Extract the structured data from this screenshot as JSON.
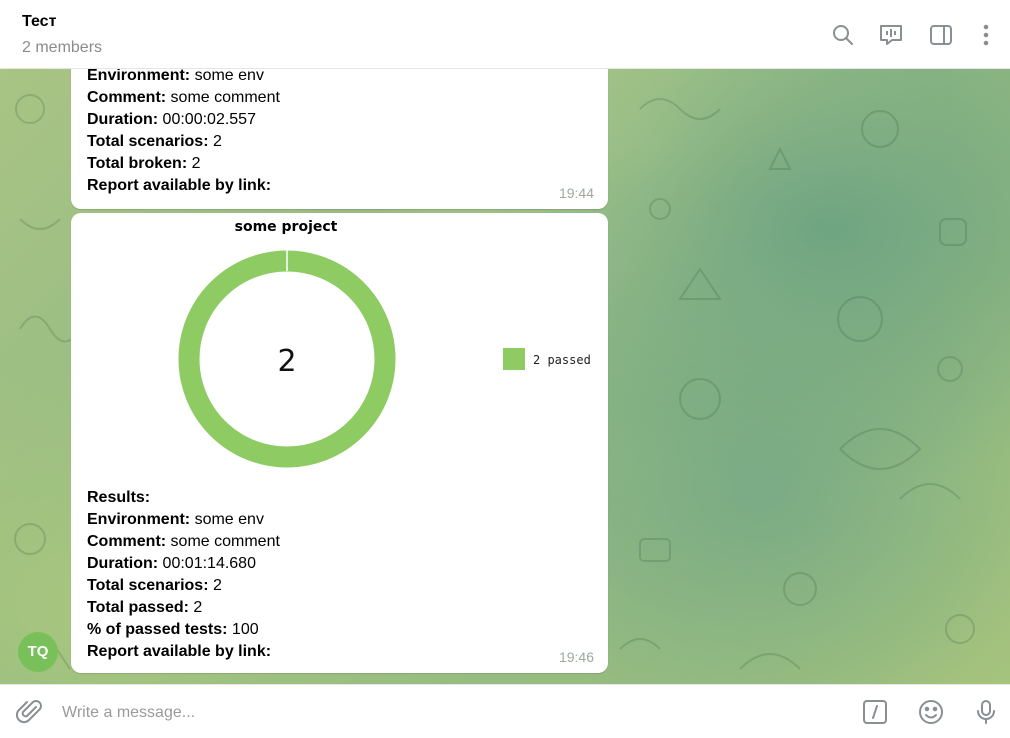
{
  "header": {
    "title": "Тест",
    "subtitle": "2 members",
    "icons": [
      "search-icon",
      "voice-chat-icon",
      "sidebar-toggle-icon",
      "more-vert-icon"
    ]
  },
  "messages": [
    {
      "lines": [
        {
          "label": "Environment:",
          "value": " some env"
        },
        {
          "label": "Comment:",
          "value": " some comment"
        },
        {
          "label": "Duration:",
          "value": " 00:00:02.557"
        },
        {
          "label": "Total scenarios:",
          "value": " 2"
        },
        {
          "label": "Total broken:",
          "value": " 2"
        },
        {
          "label": "Report available by link:",
          "value": ""
        }
      ],
      "time": "19:44"
    },
    {
      "lines": [
        {
          "label": "Results:",
          "value": ""
        },
        {
          "label": "Environment:",
          "value": " some env"
        },
        {
          "label": "Comment:",
          "value": " some comment"
        },
        {
          "label": "Duration:",
          "value": " 00:01:14.680"
        },
        {
          "label": "Total scenarios:",
          "value": " 2"
        },
        {
          "label": "Total passed:",
          "value": " 2"
        },
        {
          "label": "% of passed tests:",
          "value": " 100"
        },
        {
          "label": "Report available by link:",
          "value": ""
        }
      ],
      "time": "19:46"
    }
  ],
  "chart_data": {
    "type": "pie",
    "title": "some project",
    "center_label": "2",
    "series": [
      {
        "name": "2 passed",
        "value": 2,
        "color": "#8ecb63"
      }
    ],
    "legend_position": "right"
  },
  "avatar": {
    "initials": "TQ",
    "color": "#79c05a"
  },
  "composer": {
    "placeholder": "Write a message...",
    "icons": [
      "attach-icon",
      "bot-commands-icon",
      "emoji-icon",
      "microphone-icon"
    ]
  },
  "colors": {
    "accent": "#79c05a",
    "chart_green": "#8ecb63"
  }
}
